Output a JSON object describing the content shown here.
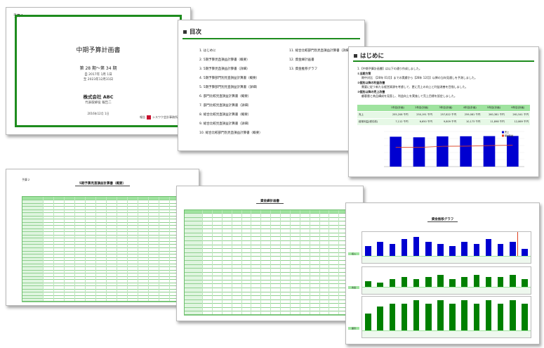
{
  "colors": {
    "accent": "#1e8c1e",
    "header_fill": "#9fe39f",
    "bar_blue": "#0000d0",
    "bar_green": "#008000",
    "line_red": "#e04020"
  },
  "cover": {
    "page_label": "予算１",
    "title": "中期予算計画書",
    "term": "第 28 期～第 34 期",
    "date_from": "自 2017年 1月 1日",
    "date_to": "至 2023年12月31日",
    "company": "株式会社 ABC",
    "representative": "代表取締役 報告二",
    "created_date": "2016年12月 1日",
    "maker_prefix": "報告",
    "maker_name": "シスワク会計事務所"
  },
  "toc": {
    "heading": "目次",
    "left_items": [
      "1. はじめに",
      "2. 5期予算見直損益計算書（概要）",
      "3. 5期予算見直損益計算書（詳細）",
      "4. 5期予算部門別見直損益計算書（概要）",
      "5. 5期予算部門別見直損益計算書（詳細）",
      "6. 部門比較見直損益計算書（概要）",
      "7. 部門比較見直損益計算書（詳細）",
      "8. 総合比較見直損益計算書（概要）",
      "9. 総合比較見直損益計算書（詳細）",
      "10. 総合比較部門別見直損益計算書（概要）"
    ],
    "right_items": [
      "11. 総合比較部門別見直損益計算書（詳細）",
      "12. 資金繰計画書",
      "13. 資金推移グラフ"
    ]
  },
  "intro": {
    "heading": "はじめに",
    "lead": "1.【中期予算計画書】は以下の通り作成しました。",
    "h1": "①当期方策",
    "t1": "期中対比　【28年 01月】までの実績から【28年 12月】以降の当年見通しを予測しました。",
    "h2": "②個別以降の利益改善",
    "t2": "需要に従う新たな経営資源を考慮して、更に売上の向上と利益改善を目指しました。",
    "h3": "③個別以降の売上改善",
    "t3": "顧客層と商品構成を見直し、利益向上を実施して売上目標を設定しました。",
    "table": {
      "headers": [
        "",
        "1年目(計画)",
        "2年目(計画)",
        "3年目(計画)",
        "4年目(計画)",
        "5年目(計画)",
        "6年目(計画)"
      ],
      "rows": [
        {
          "label": "売上",
          "values": [
            "255,208 千円",
            "250,191 千円",
            "257,822 千円",
            "259,081 千円",
            "260,381 千円",
            "261,541 千円"
          ]
        },
        {
          "label": "経常利益(税引前)",
          "values": [
            "7,112 千円",
            "6,650 千円",
            "9,809 千円",
            "10,173 千円",
            "11,898 千円",
            "12,869 千円"
          ]
        }
      ]
    },
    "chart_legend": [
      "売上",
      "経常利益"
    ]
  },
  "chart_data": {
    "type": "bar",
    "categories": [
      "1年目",
      "2年目",
      "3年目",
      "4年目",
      "5年目",
      "6年目"
    ],
    "series": [
      {
        "name": "売上",
        "values": [
          255208,
          250191,
          257822,
          259081,
          260381,
          261541
        ]
      },
      {
        "name": "経常利益",
        "values": [
          7112,
          6650,
          9809,
          10173,
          11898,
          12869
        ]
      }
    ],
    "ylim": [
      0,
      300000
    ]
  },
  "ss1": {
    "page_label": "予算２",
    "title": "5期予算見直損益計算書（概要）"
  },
  "ss2": {
    "title": "資金繰計画書"
  },
  "graph": {
    "title": "資金推移グラフ",
    "panel_labels": [
      "収入",
      "支出",
      "差引"
    ],
    "panel1_values": [
      4,
      6,
      5,
      7,
      8,
      6,
      5,
      4,
      6,
      5,
      7,
      5,
      6,
      3
    ],
    "panel2_values": [
      3,
      2,
      4,
      5,
      4,
      5,
      6,
      4,
      5,
      6,
      5,
      5,
      6,
      4
    ],
    "panel3_values": [
      5,
      7,
      8,
      8,
      9,
      8,
      9,
      8,
      9,
      8,
      9,
      8,
      9,
      8
    ]
  }
}
